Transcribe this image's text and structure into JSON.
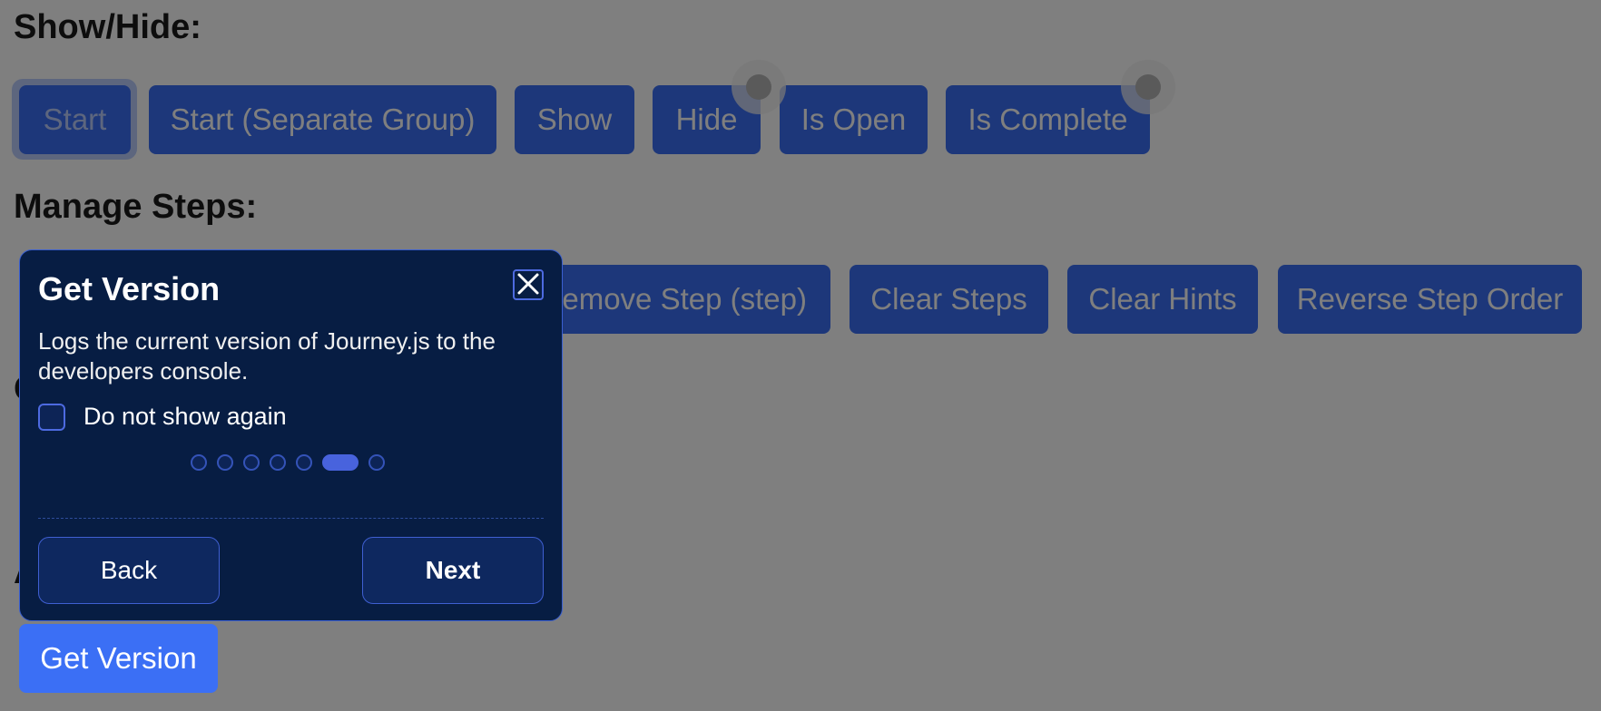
{
  "sections": {
    "show_hide": {
      "title": "Show/Hide:",
      "buttons": [
        "Start",
        "Start (Separate Group)",
        "Show",
        "Hide",
        "Is Open",
        "Is Complete"
      ]
    },
    "manage_steps": {
      "title": "Manage Steps:",
      "buttons": [
        "Remove Step (step)",
        "Clear Steps",
        "Clear Hints",
        "Reverse Step Order"
      ]
    },
    "obscured_titles": [
      "C",
      "A"
    ],
    "highlighted_button": "Get Version"
  },
  "dialog": {
    "title": "Get Version",
    "description": "Logs the current version of Journey.js to the developers console.",
    "dont_show_again": "Do not show again",
    "dont_show_checked": false,
    "progress": {
      "total": 7,
      "current": 6
    },
    "back_label": "Back",
    "next_label": "Next"
  },
  "colors": {
    "button_bg": "#3b6ff5",
    "dialog_bg": "#071d43",
    "overlay": "rgba(0,0,0,0.5)"
  },
  "icons": {
    "close": "close-icon",
    "hint_marker": "hint-marker-icon"
  }
}
